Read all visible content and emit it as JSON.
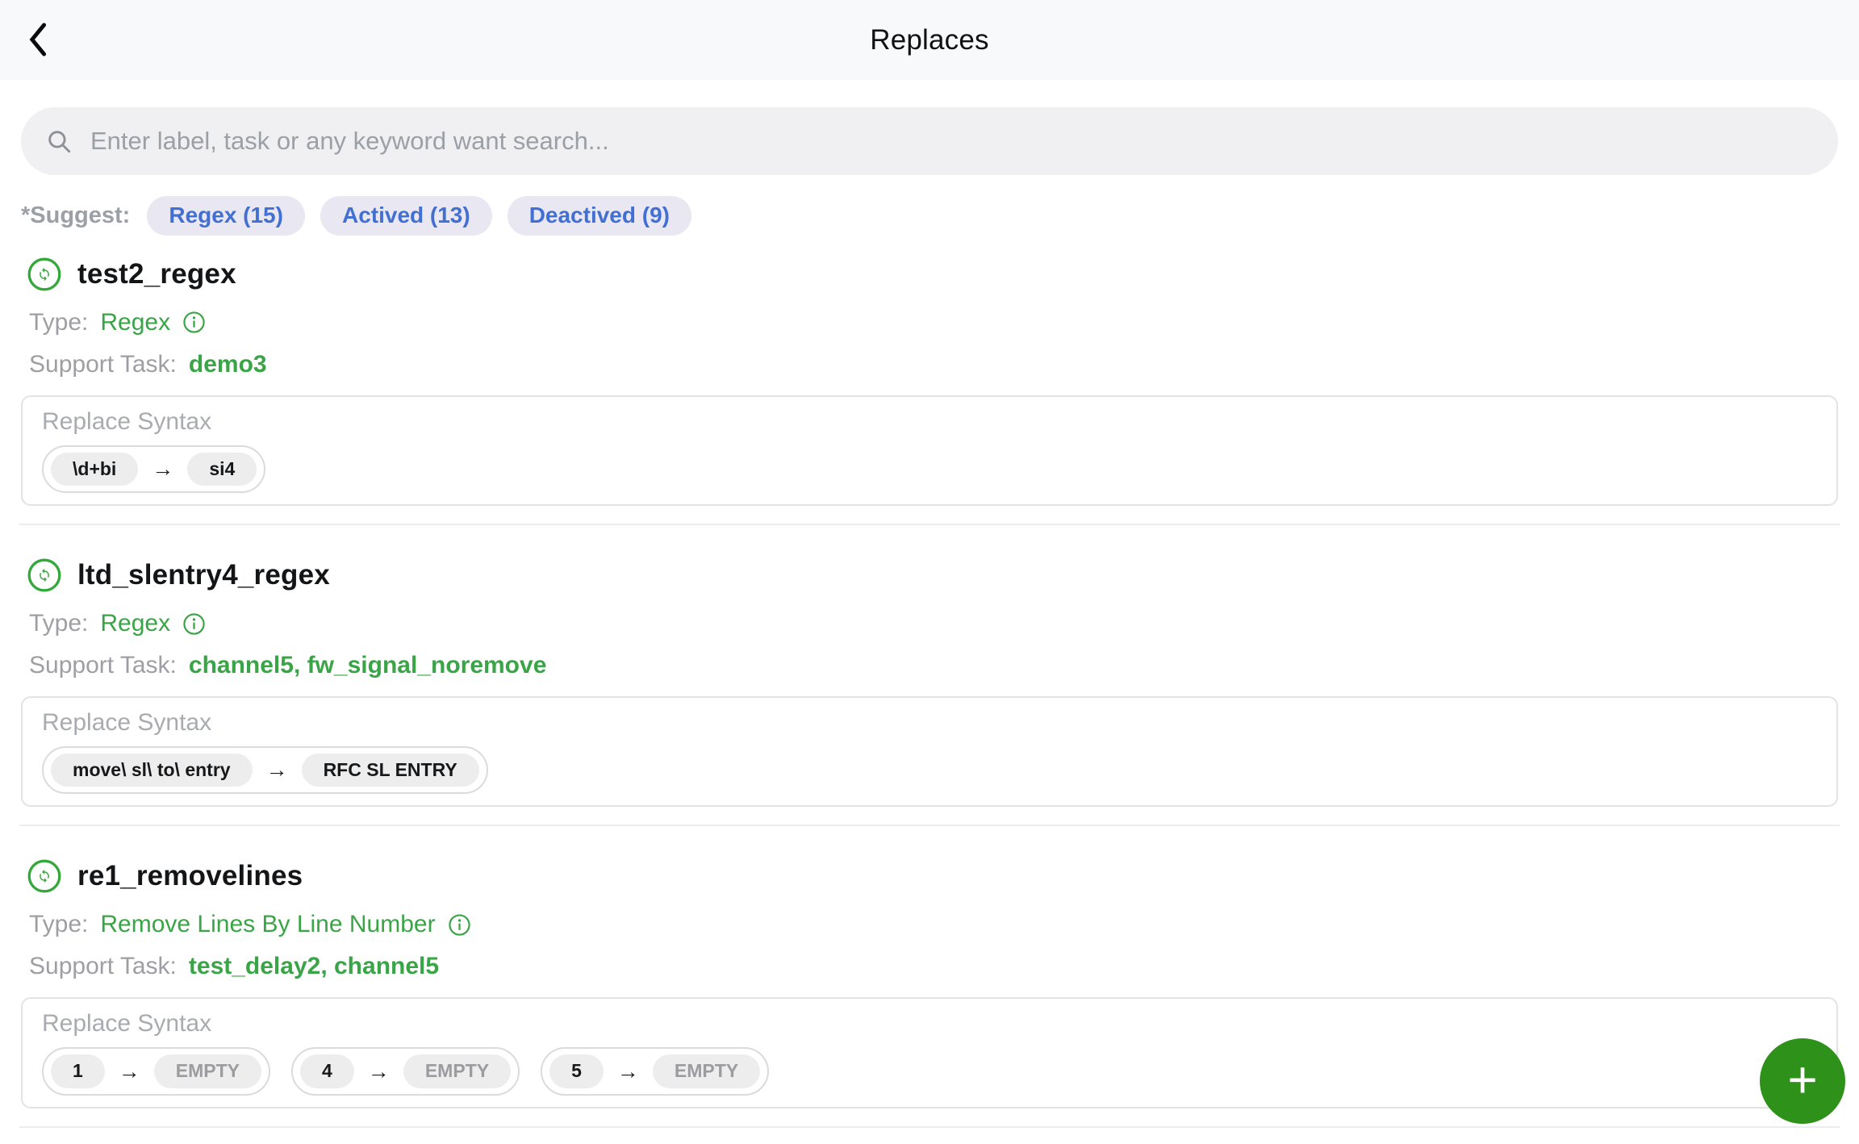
{
  "header": {
    "title": "Replaces"
  },
  "search": {
    "placeholder": "Enter label, task or any keyword want search..."
  },
  "suggest": {
    "label": "*Suggest:",
    "chips": [
      {
        "label": "Regex (15)"
      },
      {
        "label": "Actived (13)"
      },
      {
        "label": "Deactived (9)"
      }
    ]
  },
  "labels": {
    "type": "Type:",
    "support": "Support Task:",
    "syntax": "Replace Syntax"
  },
  "glyphs": {
    "arrow": "→",
    "plus": "+"
  },
  "items": [
    {
      "title": "test2_regex",
      "type_value": "Regex",
      "support_value": "demo3",
      "rules": [
        {
          "from": "\\d+bi",
          "to": "si4"
        }
      ]
    },
    {
      "title": "ltd_slentry4_regex",
      "type_value": "Regex",
      "support_value": "channel5, fw_signal_noremove",
      "rules": [
        {
          "from": "move\\ sl\\ to\\ entry",
          "to": "RFC SL ENTRY"
        }
      ]
    },
    {
      "title": "re1_removelines",
      "type_value": "Remove Lines By Line Number",
      "support_value": "test_delay2, channel5",
      "rules": [
        {
          "from": "1",
          "to": "EMPTY"
        },
        {
          "from": "4",
          "to": "EMPTY"
        },
        {
          "from": "5",
          "to": "EMPTY"
        }
      ]
    }
  ],
  "icons": {
    "back": "back-icon",
    "search": "search-icon",
    "sync": "sync-icon",
    "info": "info-icon",
    "plus": "plus-icon"
  },
  "colors": {
    "accent_green": "#3aa546",
    "fab_green": "#2e9119",
    "chip_blue": "#4270d2",
    "chip_bg": "#e9e7f2",
    "header_bg": "#f8f9fb",
    "search_bg": "#f0f0f2"
  }
}
